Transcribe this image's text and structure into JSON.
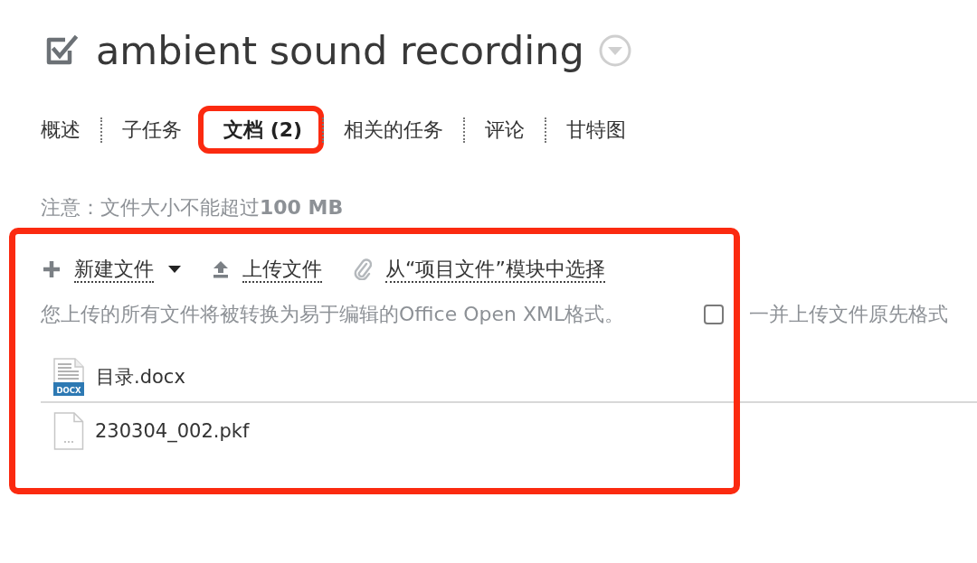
{
  "header": {
    "title": "ambient sound recording"
  },
  "tabs": [
    {
      "label": "概述",
      "selected": false,
      "highlighted": false
    },
    {
      "label": "子任务",
      "selected": false,
      "highlighted": false
    },
    {
      "label": "文档 (2)",
      "selected": true,
      "highlighted": true
    },
    {
      "label": "相关的任务",
      "selected": false,
      "highlighted": false
    },
    {
      "label": "评论",
      "selected": false,
      "highlighted": false
    },
    {
      "label": "甘特图",
      "selected": false,
      "highlighted": false
    }
  ],
  "notice": "注意：文件大小不能超过**100 MB**",
  "files_panel": {
    "highlighted": true,
    "toolbar": [
      {
        "kind": "new",
        "label": "新建文件",
        "dropdown": true
      },
      {
        "kind": "upload",
        "label": "上传文件",
        "dropdown": false
      },
      {
        "kind": "attach",
        "label": "从“项目文件”模块中选择",
        "dropdown": false
      }
    ],
    "conversion_note": "您上传的所有文件将被转换为易于编辑的Office Open XML格式。",
    "keep_original_format": {
      "label": "一并上传文件原先格式",
      "checked": false
    },
    "files": [
      {
        "kind": "docx",
        "name": "目录.docx",
        "badge": "DOCX"
      },
      {
        "kind": "generic",
        "name": "230304_002.pkf"
      }
    ]
  }
}
